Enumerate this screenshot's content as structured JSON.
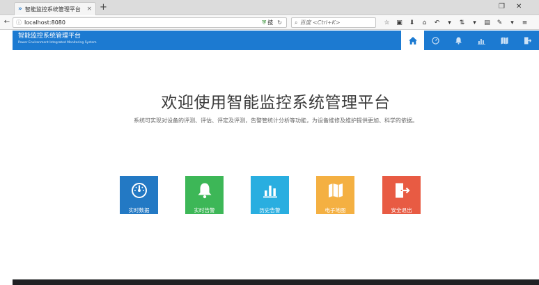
{
  "browser": {
    "tab_title": "智能监控系统管理平台",
    "tab_close": "×",
    "new_tab": "+",
    "url": "localhost:8080",
    "search_placeholder": "百度 <Ctrl+K>",
    "extension_label": "技"
  },
  "app": {
    "brand_cn": "智能监控系统管理平台",
    "brand_en": "Power Environment Integrated Monitoring System",
    "nav": [
      {
        "name": "home-icon",
        "active": true
      },
      {
        "name": "gauge-icon",
        "active": false
      },
      {
        "name": "bell-icon",
        "active": false
      },
      {
        "name": "bar-chart-icon",
        "active": false
      },
      {
        "name": "map-icon",
        "active": false
      },
      {
        "name": "exit-icon",
        "active": false
      }
    ]
  },
  "main": {
    "title": "欢迎使用智能监控系统管理平台",
    "subtitle": "系统可实现对设备的评测、评估、评定及评测，告警管统计分析等功能，为设备维修及维护提供更加、科学的依据。",
    "tiles": [
      {
        "label": "实时数据",
        "color": "#2379c4",
        "icon": "gauge-icon"
      },
      {
        "label": "实时告警",
        "color": "#3db757",
        "icon": "bell-icon"
      },
      {
        "label": "历史告警",
        "color": "#29aee0",
        "icon": "bar-chart-icon"
      },
      {
        "label": "电子地图",
        "color": "#f4b042",
        "icon": "map-icon"
      },
      {
        "label": "安全退出",
        "color": "#e85b43",
        "icon": "exit-icon"
      }
    ]
  },
  "colors": {
    "header": "#1c7ad1"
  }
}
